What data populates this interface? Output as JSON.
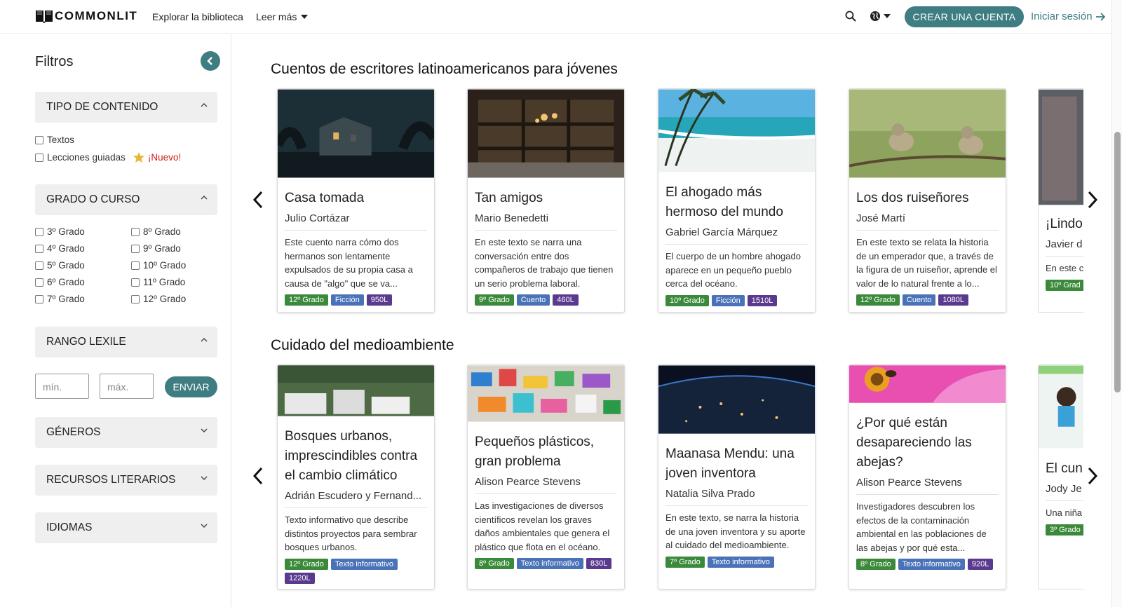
{
  "header": {
    "logo_text": "COMMONLIT",
    "nav": [
      "Explorar la biblioteca",
      "Leer más"
    ],
    "create_account": "CREAR UNA CUENTA",
    "login": "Iniciar sesión",
    "accent": "#3e7d82"
  },
  "sidebar": {
    "title": "Filtros",
    "content_type": {
      "label": "TIPO DE CONTENIDO",
      "options": [
        "Textos",
        "Lecciones guiadas"
      ],
      "new_badge": "¡Nuevo!"
    },
    "grade": {
      "label": "GRADO O CURSO",
      "col1": [
        "3º Grado",
        "4º Grado",
        "5º Grado",
        "6º Grado",
        "7º Grado"
      ],
      "col2": [
        "8º Grado",
        "9º Grado",
        "10º Grado",
        "11º Grado",
        "12º Grado"
      ]
    },
    "lexile": {
      "label": "RANGO LEXILE",
      "min_placeholder": "mín.",
      "max_placeholder": "máx.",
      "submit": "ENVIAR"
    },
    "genres": "GÉNEROS",
    "literary": "RECURSOS LITERARIOS",
    "languages": "IDIOMAS"
  },
  "sections": [
    {
      "title": "Cuentos de escritores latinoamericanos para jóvenes",
      "cards": [
        {
          "title": "Casa tomada",
          "author": "Julio Cortázar",
          "desc": "Este cuento narra cómo dos hermanos son lentamente expulsados de su propia casa a causa de \"algo\" que se va...",
          "tags": [
            "12º Grado",
            "Ficción",
            "950L"
          ]
        },
        {
          "title": "Tan amigos",
          "author": "Mario Benedetti",
          "desc": "En este texto se narra una conversación entre dos compañeros de trabajo que tienen un serio problema laboral.",
          "tags": [
            "9º Grado",
            "Cuento",
            "460L"
          ]
        },
        {
          "title": "El ahogado más hermoso del mundo",
          "author": "Gabriel García Márquez",
          "desc": "El cuerpo de un hombre ahogado aparece en un pequeño pueblo cerca del océano.",
          "tags": [
            "10º Grado",
            "Ficción",
            "1510L"
          ]
        },
        {
          "title": "Los dos ruiseñores",
          "author": "José Martí",
          "desc": "En este texto se relata la historia de un emperador que, a través de la figura de un ruiseñor, aprende el valor de lo natural frente a lo...",
          "tags": [
            "12º Grado",
            "Cuento",
            "1080L"
          ]
        },
        {
          "title": "¡Lindo",
          "author": "Javier d",
          "desc": "En este c particula",
          "tags": [
            "10º Grad"
          ]
        }
      ]
    },
    {
      "title": "Cuidado del medioambiente",
      "cards": [
        {
          "title": "Bosques urbanos, imprescindibles contra el cambio climático",
          "author": "Adrián Escudero y Fernand...",
          "desc": "Texto informativo que describe distintos proyectos para sembrar bosques urbanos.",
          "tags": [
            "12º Grado",
            "Texto informativo",
            "1220L"
          ]
        },
        {
          "title": "Pequeños plásticos, gran problema",
          "author": "Alison Pearce Stevens",
          "desc": "Las investigaciones de diversos científicos revelan los graves daños ambientales que genera el plástico que flota en el océano.",
          "tags": [
            "8º Grado",
            "Texto informativo",
            "830L"
          ]
        },
        {
          "title": "Maanasa Mendu: una joven inventora",
          "author": "Natalia Silva Prado",
          "desc": "En este texto, se narra la historia de una joven inventora y su aporte al cuidado del medioambiente.",
          "tags": [
            "7º Grado",
            "Texto informativo"
          ]
        },
        {
          "title": "¿Por qué están desapareciendo las abejas?",
          "author": "Alison Pearce Stevens",
          "desc": "Investigadores descubren los efectos de la contaminación ambiental en las poblaciones de las abejas y por qué esta...",
          "tags": [
            "8º Grado",
            "Texto informativo",
            "920L"
          ]
        },
        {
          "title": "El cun Día de",
          "author": "Jody Je",
          "desc": "Una niña ambient cumplea",
          "tags": [
            "3º Grado"
          ]
        }
      ]
    }
  ]
}
